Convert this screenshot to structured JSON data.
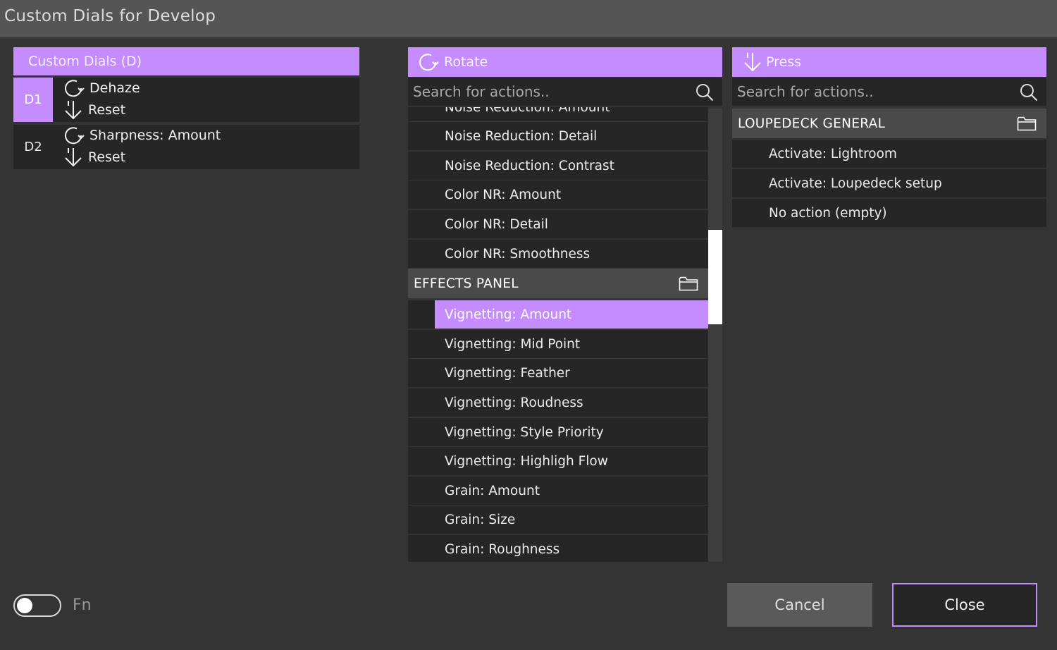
{
  "window": {
    "title": "Custom Dials for Develop"
  },
  "dials": {
    "header": "Custom Dials (D)",
    "rows": [
      {
        "key": "D1",
        "rotate": "Dehaze",
        "press": "Reset"
      },
      {
        "key": "D2",
        "rotate": "Sharpness: Amount",
        "press": "Reset"
      }
    ]
  },
  "rotate": {
    "header": "Rotate",
    "search_placeholder": "Search for actions..",
    "cut_item": "Noise Reduction: Amount",
    "items_a": [
      "Noise Reduction: Detail",
      "Noise Reduction: Contrast",
      "Color NR: Amount",
      "Color NR: Detail",
      "Color NR: Smoothness"
    ],
    "group": "EFFECTS PANEL",
    "selected": "Vignetting: Amount",
    "items_b": [
      "Vignetting: Mid Point",
      "Vignetting: Feather",
      "Vignetting: Roudness",
      "Vignetting: Style Priority",
      "Vignetting: Highligh Flow",
      "Grain: Amount",
      "Grain: Size",
      "Grain: Roughness"
    ]
  },
  "press": {
    "header": "Press",
    "search_placeholder": "Search for actions..",
    "group": "LOUPEDECK GENERAL",
    "items": [
      "Activate: Lightroom",
      "Activate: Loupedeck setup",
      "No action (empty)"
    ]
  },
  "footer": {
    "fn_label": "Fn",
    "cancel": "Cancel",
    "close": "Close"
  },
  "colors": {
    "accent": "#c48cff",
    "panel": "#262626",
    "background": "#343434"
  }
}
